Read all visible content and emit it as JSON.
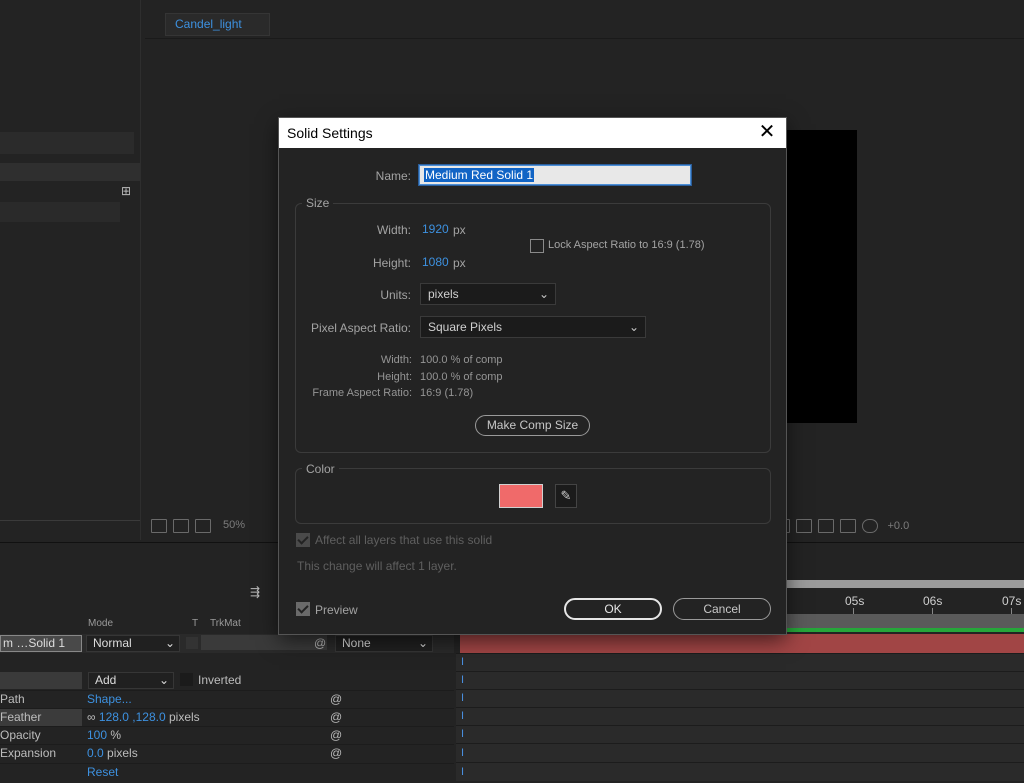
{
  "composition": {
    "tab_label": "Candel_light",
    "zoom_label": "50%",
    "exposure_label": "+0.0"
  },
  "timeline": {
    "columns": {
      "mode": "Mode",
      "t": "T",
      "trkmat": "TrkMat"
    },
    "layer": {
      "name": "m …Solid 1",
      "mode": "Normal",
      "trkmat": "None"
    },
    "mask": {
      "mode": "Add",
      "inverted_label": "Inverted"
    },
    "properties": [
      {
        "label": "Path",
        "value": "Shape...",
        "unit": ""
      },
      {
        "label": "Feather",
        "value": "128.0 ,128.0",
        "unit": "pixels"
      },
      {
        "label": "Opacity",
        "value": "100",
        "unit": "%"
      },
      {
        "label": "Expansion",
        "value": "0.0",
        "unit": "pixels"
      },
      {
        "label": "",
        "value": "Reset",
        "unit": ""
      }
    ],
    "ruler_labels": [
      "05s",
      "06s",
      "07s"
    ]
  },
  "dialog": {
    "title": "Solid Settings",
    "close_glyph": "✕",
    "name_label": "Name:",
    "name_value": "Medium Red Solid 1",
    "size_group": "Size",
    "width_label": "Width:",
    "width_value": "1920",
    "height_label": "Height:",
    "height_value": "1080",
    "px_unit": "px",
    "lock_label": "Lock Aspect Ratio to 16:9 (1.78)",
    "lock_checked": false,
    "units_label": "Units:",
    "units_value": "pixels",
    "par_label": "Pixel Aspect Ratio:",
    "par_value": "Square Pixels",
    "info": {
      "width_label": "Width:",
      "width_value": "100.0 % of comp",
      "height_label": "Height:",
      "height_value": "100.0 % of comp",
      "far_label": "Frame Aspect Ratio:",
      "far_value": "16:9 (1.78)"
    },
    "make_comp_size": "Make Comp Size",
    "color_group": "Color",
    "color_value": "#f06a6a",
    "affect_label": "Affect all layers that use this solid",
    "affect_note": "This change will affect 1 layer.",
    "preview_label": "Preview",
    "preview_checked": true,
    "ok_label": "OK",
    "cancel_label": "Cancel"
  },
  "colors": {
    "accent_blue": "#3d91e0",
    "solid_red": "#f06a6a",
    "track_red": "#a14545"
  }
}
